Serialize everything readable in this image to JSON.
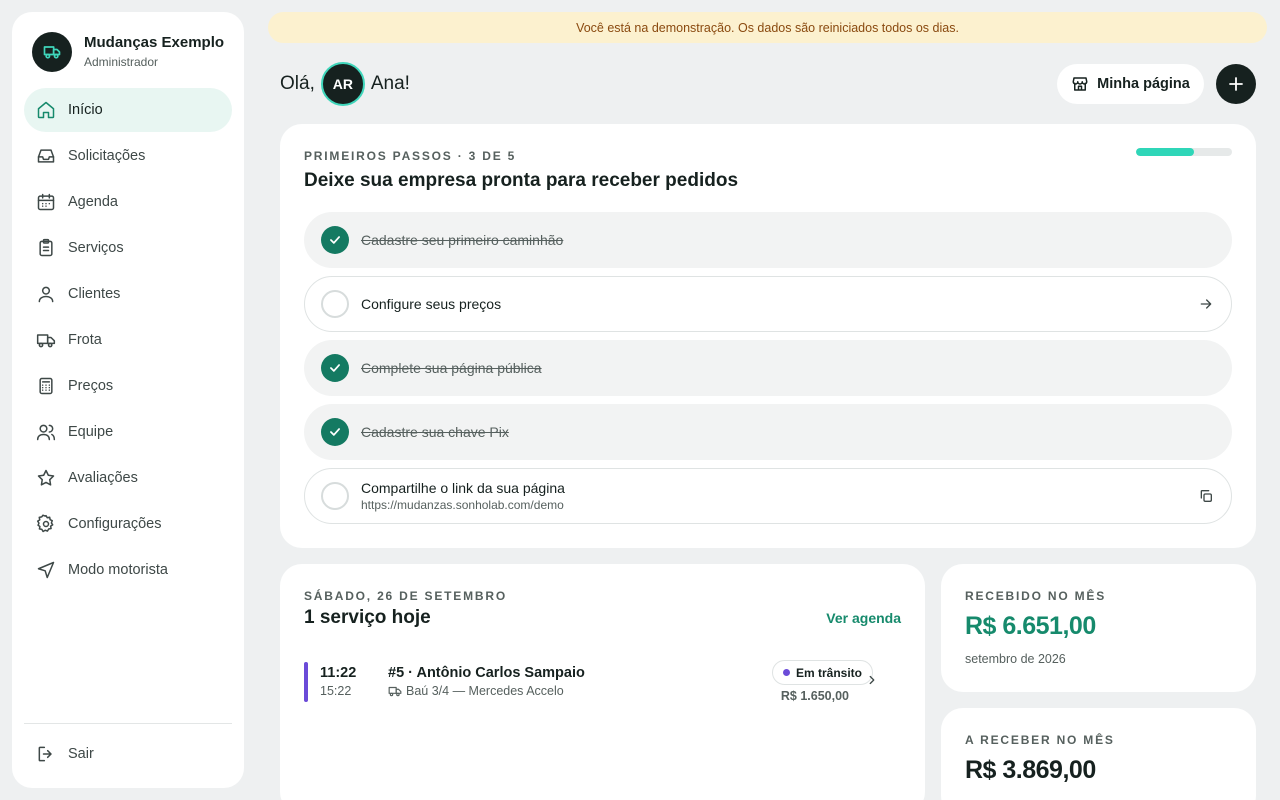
{
  "sidebar": {
    "company_name": "Mudanças Exemplo",
    "role": "Administrador",
    "items": [
      {
        "label": "Início",
        "icon": "home-icon",
        "active": true
      },
      {
        "label": "Solicitações",
        "icon": "inbox-icon"
      },
      {
        "label": "Agenda",
        "icon": "calendar-icon"
      },
      {
        "label": "Serviços",
        "icon": "clipboard-icon"
      },
      {
        "label": "Clientes",
        "icon": "user-icon"
      },
      {
        "label": "Frota",
        "icon": "truck-icon"
      },
      {
        "label": "Preços",
        "icon": "calculator-icon"
      },
      {
        "label": "Equipe",
        "icon": "users-icon"
      },
      {
        "label": "Avaliações",
        "icon": "star-icon"
      },
      {
        "label": "Configurações",
        "icon": "gear-icon"
      },
      {
        "label": "Modo motorista",
        "icon": "navigation-icon"
      }
    ],
    "logout_label": "Sair"
  },
  "banner": {
    "text": "Você está na demonstração. Os dados são reiniciados todos os dias."
  },
  "header": {
    "greeting_prefix": "Olá,",
    "avatar_initials": "AR",
    "user_name": "Ana!",
    "my_page_label": "Minha página"
  },
  "onboarding": {
    "eyebrow": "PRIMEIROS PASSOS · 3 DE 5",
    "title": "Deixe sua empresa pronta para receber pedidos",
    "progress": 0.6,
    "steps": [
      {
        "label": "Cadastre seu primeiro caminhão",
        "done": true
      },
      {
        "label": "Configure seus preços",
        "done": false,
        "action_icon": "arrow-right-icon"
      },
      {
        "label": "Complete sua página pública",
        "done": true
      },
      {
        "label": "Cadastre sua chave Pix",
        "done": true
      },
      {
        "label": "Compartilhe o link da sua página",
        "sub": "https://mudanzas.sonholab.com/demo",
        "done": false,
        "action_icon": "copy-icon"
      }
    ]
  },
  "today": {
    "eyebrow": "SÁBADO, 26 DE SETEMBRO",
    "title": "1 serviço hoje",
    "link_label": "Ver agenda",
    "job": {
      "start": "11:22",
      "end": "15:22",
      "title": "#5 · Antônio Carlos Sampaio",
      "vehicle": "Baú 3/4 — Mercedes Accelo",
      "status": "Em trânsito",
      "status_color": "#6b4bd8",
      "price": "R$ 1.650,00"
    }
  },
  "stats": {
    "received": {
      "eyebrow": "RECEBIDO NO MÊS",
      "value": "R$ 6.651,00",
      "sub": "setembro de 2026"
    },
    "receivable": {
      "eyebrow": "A RECEBER NO MÊS",
      "value": "R$ 3.869,00"
    }
  },
  "colors": {
    "accent": "#168a6c",
    "dark": "#16211f",
    "progress": "#2fd6b8",
    "banner_bg": "#fcf1cf"
  }
}
